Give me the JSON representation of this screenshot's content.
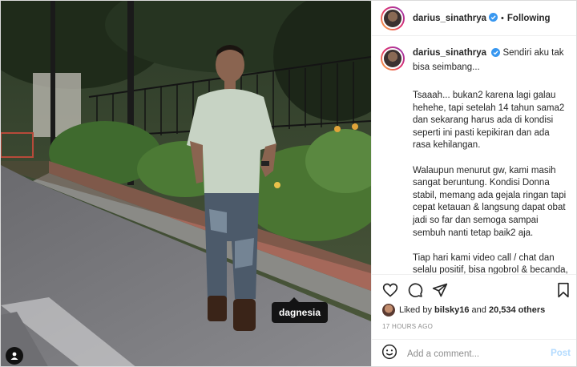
{
  "post": {
    "username": "darius_sinathrya",
    "follow_label": "Following",
    "header_separator": "•",
    "caption_first": "Sendiri aku tak bisa seimbang...",
    "caption_paragraphs": [
      "Tsaaah... bukan2 karena lagi galau hehehe, tapi setelah 14 tahun sama2 dan sekarang harus ada di kondisi seperti ini pasti kepikiran dan ada rasa kehilangan.",
      "Walaupun menurut gw, kami masih sangat beruntung. Kondisi Donna stabil, memang ada gejala ringan tapi cepat ketauan & langsung dapat obat jadi so far dan semoga sampai sembuh nanti tetap baik2 aja.",
      "Tiap hari kami video call / chat dan selalu positif, bisa ngobrol & becanda, sharing banyak hal walau mulai rindu karena berjarak secara fisik. Beruntung"
    ],
    "tag_label": "dagnesia",
    "likes_prefix": "Liked by",
    "liked_by_user": "bilsky16",
    "likes_and": "and",
    "likes_others": "20,534 others",
    "timestamp": "17 HOURS AGO",
    "comment_placeholder": "Add a comment...",
    "post_button": "Post"
  },
  "icons": {
    "like": "heart-icon",
    "comment": "comment-icon",
    "share": "paper-plane-icon",
    "save": "bookmark-icon",
    "emoji": "smiley-icon",
    "verified": "verified-badge-icon",
    "tags": "user-tag-icon"
  },
  "colors": {
    "verified_blue": "#3897f0",
    "post_button_disabled": "#b3dbff",
    "secondary_text": "#8e8e8e"
  }
}
